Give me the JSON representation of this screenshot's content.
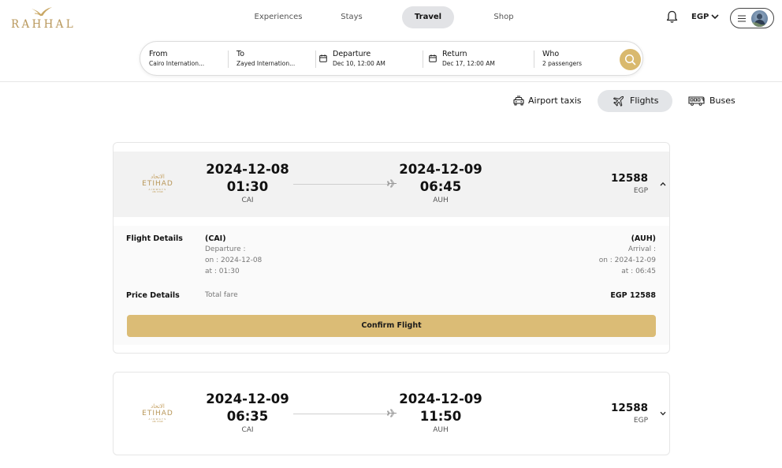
{
  "brand": {
    "name": "RAHHAL"
  },
  "nav": {
    "items": [
      {
        "label": "Experiences",
        "active": false
      },
      {
        "label": "Stays",
        "active": false
      },
      {
        "label": "Travel",
        "active": true
      },
      {
        "label": "Shop",
        "active": false
      }
    ]
  },
  "header": {
    "notification_icon": "bell-icon",
    "currency": "EGP",
    "menu_icon": "hamburger-icon"
  },
  "search": {
    "from_label": "From",
    "from_value": "Cairo Internation...",
    "to_label": "To",
    "to_value": "Zayed Internation...",
    "departure_label": "Departure",
    "departure_value": "Dec 10, 12:00 AM",
    "return_label": "Return",
    "return_value": "Dec 17, 12:00 AM",
    "who_label": "Who",
    "who_value": "2 passengers",
    "search_icon": "search-icon",
    "accent_color": "#d9b96e"
  },
  "modes": [
    {
      "label": "Airport taxis",
      "icon": "taxi-icon",
      "active": false
    },
    {
      "label": "Flights",
      "icon": "plane-icon",
      "active": true
    },
    {
      "label": "Buses",
      "icon": "bus-icon",
      "active": false
    }
  ],
  "flights": [
    {
      "airline_logo": {
        "arabic": "الاتحاد",
        "name": "ETIHAD",
        "sub": "AIRWAYS",
        "tagline": "ABU DHABI"
      },
      "departure_date": "2024-12-08",
      "departure_time": "01:30",
      "departure_code": "CAI",
      "arrival_date": "2024-12-09",
      "arrival_time": "06:45",
      "arrival_code": "AUH",
      "price": "12588",
      "currency": "EGP",
      "expanded": true,
      "details": {
        "flight_details_label": "Flight Details",
        "dep_code": "(CAI)",
        "dep_label": "Departure :",
        "dep_on": "on : 2024-12-08",
        "dep_at": "at : 01:30",
        "arr_code": "(AUH)",
        "arr_label": "Arrival :",
        "arr_on": "on : 2024-12-09",
        "arr_at": "at : 06:45",
        "price_details_label": "Price Details",
        "total_fare_label": "Total fare",
        "total_fare_value": "EGP 12588",
        "confirm_label": "Confirm Flight"
      }
    },
    {
      "airline_logo": {
        "arabic": "الاتحاد",
        "name": "ETIHAD",
        "sub": "AIRWAYS",
        "tagline": "ABU DHABI"
      },
      "departure_date": "2024-12-09",
      "departure_time": "06:35",
      "departure_code": "CAI",
      "arrival_date": "2024-12-09",
      "arrival_time": "11:50",
      "arrival_code": "AUH",
      "price": "12588",
      "currency": "EGP",
      "expanded": false
    }
  ]
}
